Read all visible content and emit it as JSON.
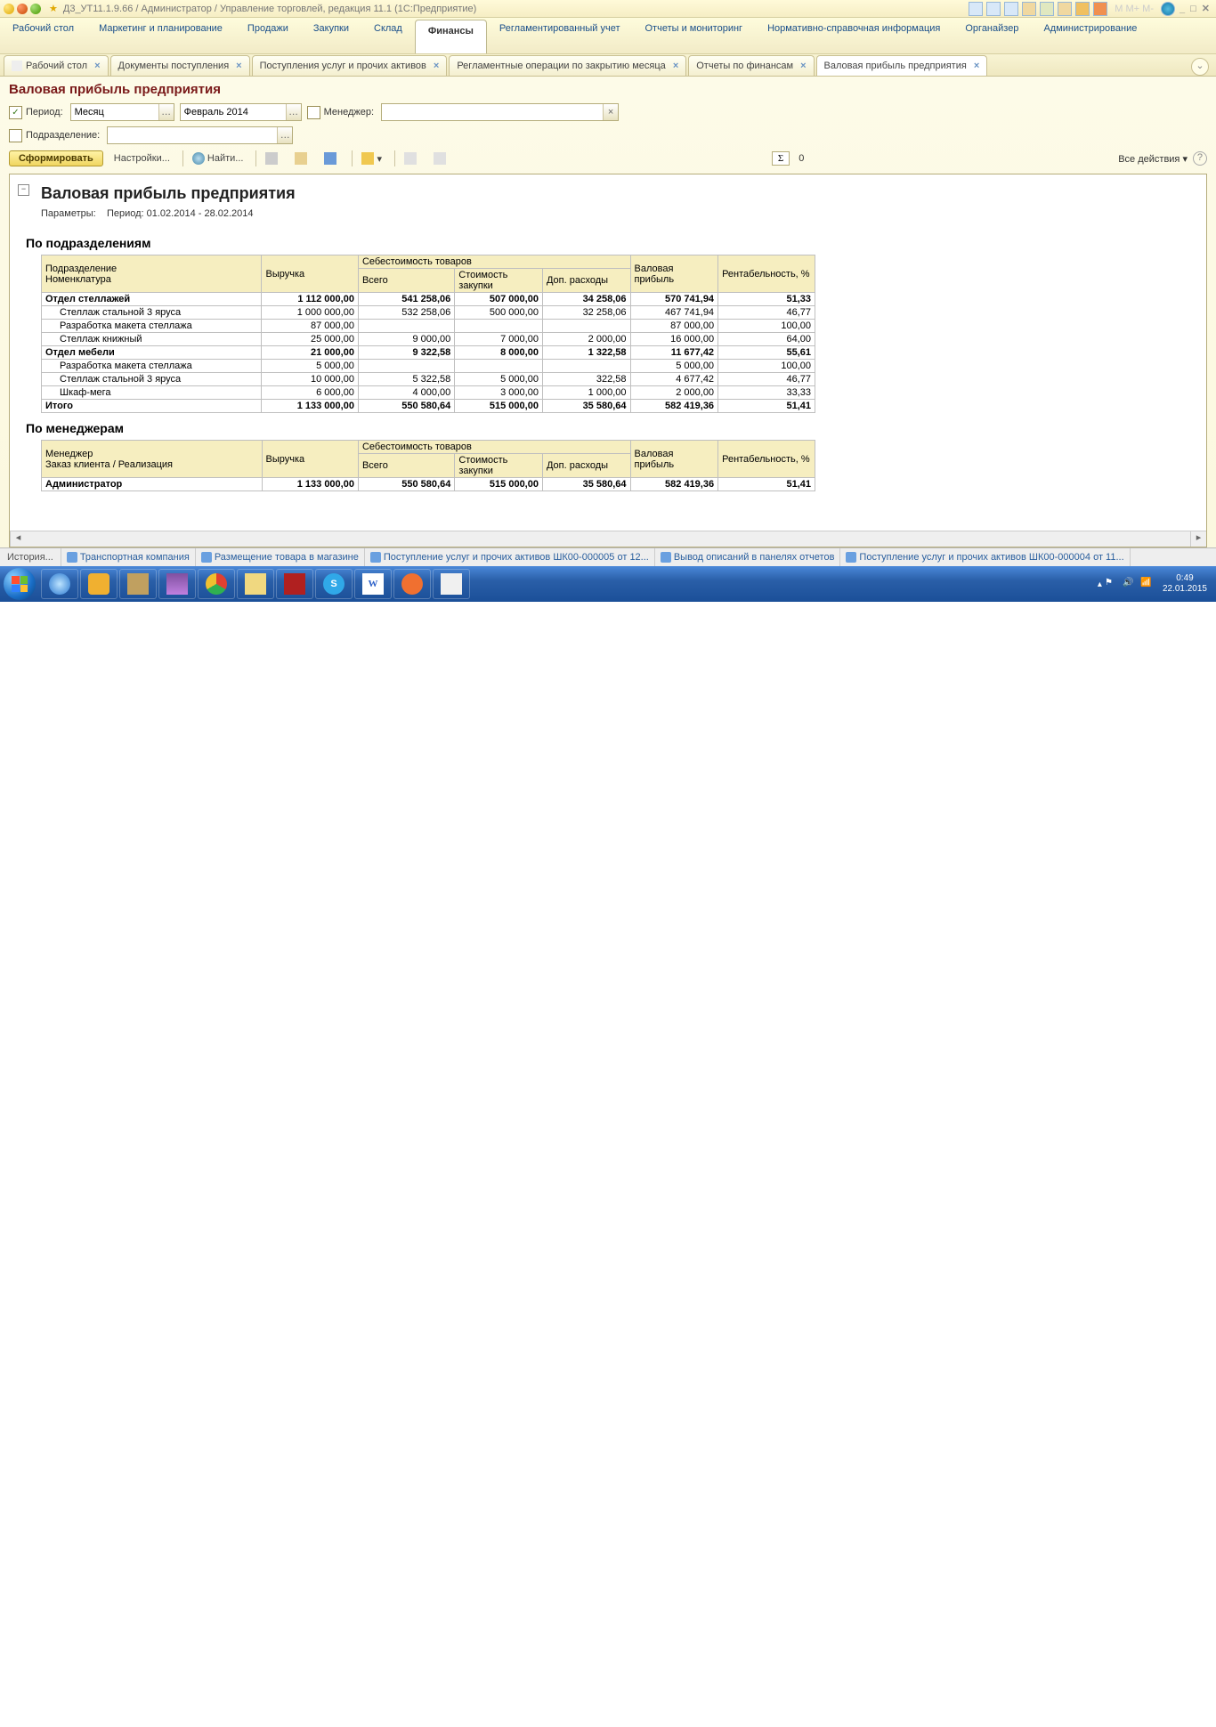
{
  "window": {
    "title": "Д3_УТ11.1.9.66 / Администратор / Управление торговлей, редакция 11.1  (1С:Предприятие)"
  },
  "mainmenu": {
    "items": [
      "Рабочий стол",
      "Маркетинг и планирование",
      "Продажи",
      "Закупки",
      "Склад",
      "Финансы",
      "Регламентированный учет",
      "Отчеты и мониторинг",
      "Нормативно-справочная информация",
      "Органайзер",
      "Администрирование"
    ],
    "active": 5
  },
  "tabs": [
    {
      "label": "Рабочий стол",
      "closable": true
    },
    {
      "label": "Документы поступления",
      "closable": true
    },
    {
      "label": "Поступления услуг и прочих активов",
      "closable": true
    },
    {
      "label": "Регламентные операции по закрытию месяца",
      "closable": true
    },
    {
      "label": "Отчеты по финансам",
      "closable": true
    },
    {
      "label": "Валовая прибыль предприятия",
      "closable": true,
      "active": true
    }
  ],
  "page": {
    "title": "Валовая прибыль предприятия",
    "filters": {
      "period_checked": true,
      "period_label": "Период:",
      "period_type": "Месяц",
      "period_value": "Февраль 2014",
      "manager_checked": false,
      "manager_label": "Менеджер:",
      "manager_value": "",
      "division_checked": false,
      "division_label": "Подразделение:",
      "division_value": ""
    },
    "toolbar": {
      "generate": "Сформировать",
      "settings": "Настройки...",
      "find": "Найти...",
      "sigma_val": "0",
      "all_actions": "Все действия"
    }
  },
  "report": {
    "title": "Валовая прибыль предприятия",
    "params_label": "Параметры:",
    "params_value": "Период: 01.02.2014 - 28.02.2014",
    "section1": "По подразделениям",
    "headers": {
      "c1": "Подразделение",
      "c1b": "Номенклатура",
      "c2": "Выручка",
      "c3": "Себестоимость товаров",
      "c3a": "Всего",
      "c3b": "Стоимость закупки",
      "c3c": "Доп. расходы",
      "c4": "Валовая прибыль",
      "c5": "Рентабельность, %"
    },
    "rows": [
      {
        "lvl": 1,
        "name": "Отдел стеллажей",
        "v": "1 112 000,00",
        "s": "541 258,06",
        "sz": "507 000,00",
        "dr": "34 258,06",
        "p": "570 741,94",
        "r": "51,33"
      },
      {
        "lvl": 2,
        "name": "Стеллаж стальной 3 яруса",
        "v": "1 000 000,00",
        "s": "532 258,06",
        "sz": "500 000,00",
        "dr": "32 258,06",
        "p": "467 741,94",
        "r": "46,77"
      },
      {
        "lvl": 2,
        "name": "Разработка макета стеллажа",
        "v": "87 000,00",
        "s": "",
        "sz": "",
        "dr": "",
        "p": "87 000,00",
        "r": "100,00"
      },
      {
        "lvl": 2,
        "name": "Стеллаж книжный",
        "v": "25 000,00",
        "s": "9 000,00",
        "sz": "7 000,00",
        "dr": "2 000,00",
        "p": "16 000,00",
        "r": "64,00"
      },
      {
        "lvl": 1,
        "name": "Отдел мебели",
        "v": "21 000,00",
        "s": "9 322,58",
        "sz": "8 000,00",
        "dr": "1 322,58",
        "p": "11 677,42",
        "r": "55,61"
      },
      {
        "lvl": 2,
        "name": "Разработка макета стеллажа",
        "v": "5 000,00",
        "s": "",
        "sz": "",
        "dr": "",
        "p": "5 000,00",
        "r": "100,00"
      },
      {
        "lvl": 2,
        "name": "Стеллаж стальной 3 яруса",
        "v": "10 000,00",
        "s": "5 322,58",
        "sz": "5 000,00",
        "dr": "322,58",
        "p": "4 677,42",
        "r": "46,77"
      },
      {
        "lvl": 2,
        "name": "Шкаф-мега",
        "v": "6 000,00",
        "s": "4 000,00",
        "sz": "3 000,00",
        "dr": "1 000,00",
        "p": "2 000,00",
        "r": "33,33"
      },
      {
        "lvl": 0,
        "name": "Итого",
        "v": "1 133 000,00",
        "s": "550 580,64",
        "sz": "515 000,00",
        "dr": "35 580,64",
        "p": "582 419,36",
        "r": "51,41"
      }
    ],
    "section2": "По менеджерам",
    "headers2": {
      "c1": "Менеджер",
      "c1b": "Заказ клиента / Реализация"
    },
    "rows2": [
      {
        "lvl": 1,
        "name": "Администратор",
        "v": "1 133 000,00",
        "s": "550 580,64",
        "sz": "515 000,00",
        "dr": "35 580,64",
        "p": "582 419,36",
        "r": "51,41"
      }
    ]
  },
  "history": {
    "btn": "История...",
    "links": [
      "Транспортная компания",
      "Размещение товара в магазине",
      "Поступление услуг и прочих активов ШК00-000005 от 12...",
      "Вывод описаний в панелях отчетов",
      "Поступление услуг и прочих активов ШК00-000004 от 11..."
    ]
  },
  "taskbar": {
    "time": "0:49",
    "date": "22.01.2015"
  }
}
